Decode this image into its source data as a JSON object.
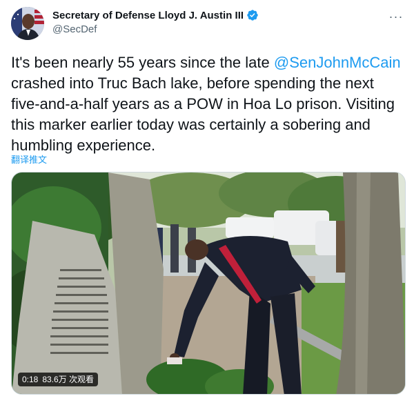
{
  "author": {
    "display_name": "Secretary of Defense Lloyd J. Austin III",
    "handle": "@SecDef",
    "avatar_icon": "user-avatar",
    "verified_icon": "verified-badge-icon"
  },
  "menu": {
    "more_icon": "more-horizontal-icon",
    "more_glyph": "···"
  },
  "tweet": {
    "text_before": "It's been nearly 55 years since the late ",
    "mention": "@SenJohnMcCain",
    "text_after": " crashed into Truc Bach lake, before spending the next five-and-a-half years as a POW in Hoa Lo prison. Visiting this marker earlier today was certainly a sobering and humbling experience.",
    "translate_label": "翻译推文"
  },
  "video": {
    "duration": "0:18",
    "views": "83.6万 次观看"
  },
  "colors": {
    "accent": "#1d9bf0",
    "text": "#0f1419",
    "secondary": "#536471",
    "border": "#cfd9de"
  }
}
